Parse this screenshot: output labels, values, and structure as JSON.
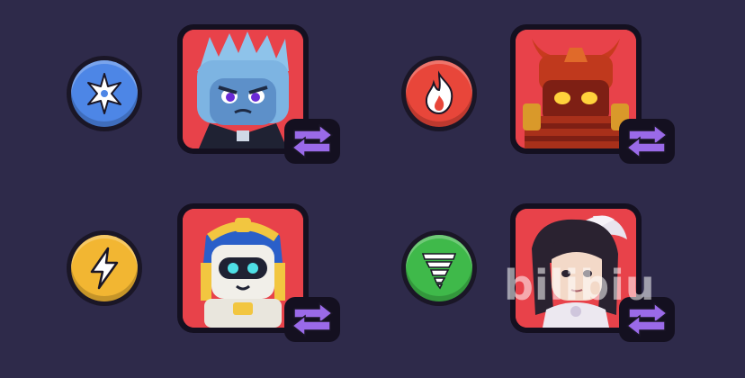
{
  "screen": {
    "background_color": "#2e2a4a"
  },
  "slots": [
    {
      "element": "ice",
      "badge_icon": "snowflake-icon",
      "badge_color": "#4d86e6",
      "portrait": "ice-knight-portrait",
      "swap_icon": "swap-arrows-icon"
    },
    {
      "element": "fire",
      "badge_icon": "flame-icon",
      "badge_color": "#e8463a",
      "portrait": "fire-samurai-portrait",
      "swap_icon": "swap-arrows-icon"
    },
    {
      "element": "lightning",
      "badge_icon": "lightning-bolt-icon",
      "badge_color": "#f2b632",
      "portrait": "pharaoh-robot-portrait",
      "swap_icon": "swap-arrows-icon"
    },
    {
      "element": "wind",
      "badge_icon": "tornado-icon",
      "badge_color": "#3fb94a",
      "portrait": "dark-haired-hero-portrait",
      "swap_icon": "swap-arrows-icon"
    }
  ],
  "watermark": {
    "text": "bilibiu"
  },
  "colors": {
    "card_frame": "#e8424a",
    "swap_purple": "#9a6ae8",
    "outline": "#141020"
  }
}
